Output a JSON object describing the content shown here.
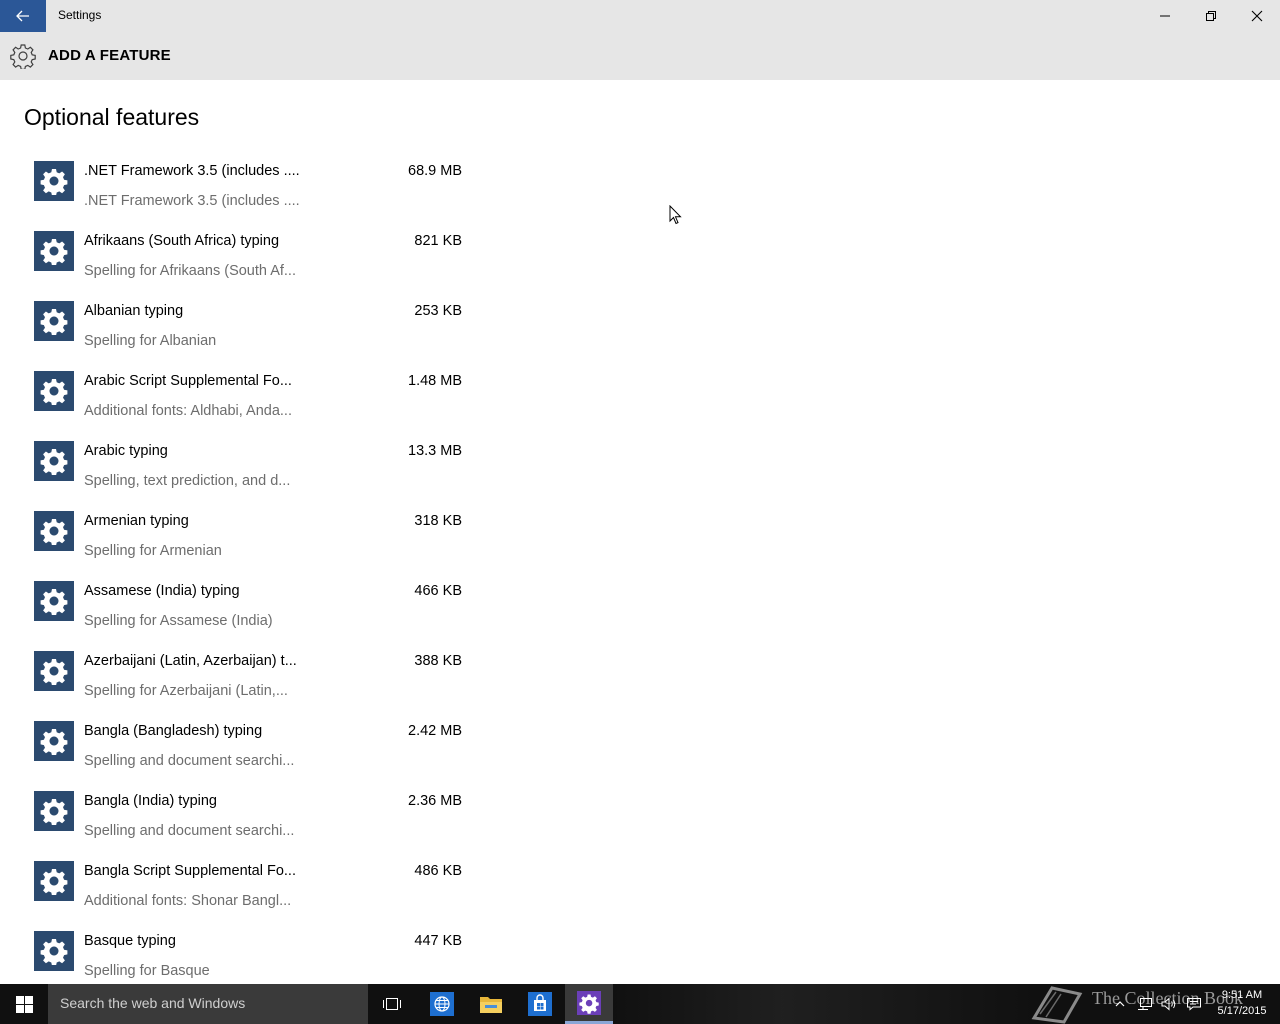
{
  "window": {
    "title": "Settings"
  },
  "header": {
    "title": "ADD A FEATURE",
    "icon": "gear-icon"
  },
  "page": {
    "title": "Optional features"
  },
  "features": [
    {
      "name": ".NET Framework 3.5 (includes ....",
      "description": ".NET Framework 3.5 (includes ....",
      "size": "68.9 MB"
    },
    {
      "name": "Afrikaans (South Africa) typing",
      "description": "Spelling for Afrikaans (South Af...",
      "size": "821 KB"
    },
    {
      "name": "Albanian typing",
      "description": "Spelling for Albanian",
      "size": "253 KB"
    },
    {
      "name": "Arabic Script Supplemental Fo...",
      "description": "Additional fonts: Aldhabi, Anda...",
      "size": "1.48 MB"
    },
    {
      "name": "Arabic typing",
      "description": "Spelling, text prediction, and d...",
      "size": "13.3 MB"
    },
    {
      "name": "Armenian typing",
      "description": "Spelling for Armenian",
      "size": "318 KB"
    },
    {
      "name": "Assamese (India) typing",
      "description": "Spelling for Assamese (India)",
      "size": "466 KB"
    },
    {
      "name": "Azerbaijani (Latin, Azerbaijan) t...",
      "description": "Spelling for Azerbaijani (Latin,...",
      "size": "388 KB"
    },
    {
      "name": "Bangla (Bangladesh) typing",
      "description": "Spelling and document searchi...",
      "size": "2.42 MB"
    },
    {
      "name": "Bangla (India) typing",
      "description": "Spelling and document searchi...",
      "size": "2.36 MB"
    },
    {
      "name": "Bangla Script Supplemental Fo...",
      "description": "Additional fonts: Shonar Bangl...",
      "size": "486 KB"
    },
    {
      "name": "Basque typing",
      "description": "Spelling for Basque",
      "size": "447 KB"
    }
  ],
  "taskbar": {
    "search_placeholder": "Search the web and Windows",
    "watermark": "The Collection Book",
    "clock_time": "9:51 AM",
    "clock_date": "5/17/2015"
  },
  "colors": {
    "accent": "#2b5797",
    "feature_icon_bg": "#2b4a6f",
    "header_bg": "#e6e6e6",
    "taskbar_bg": "#101010"
  }
}
